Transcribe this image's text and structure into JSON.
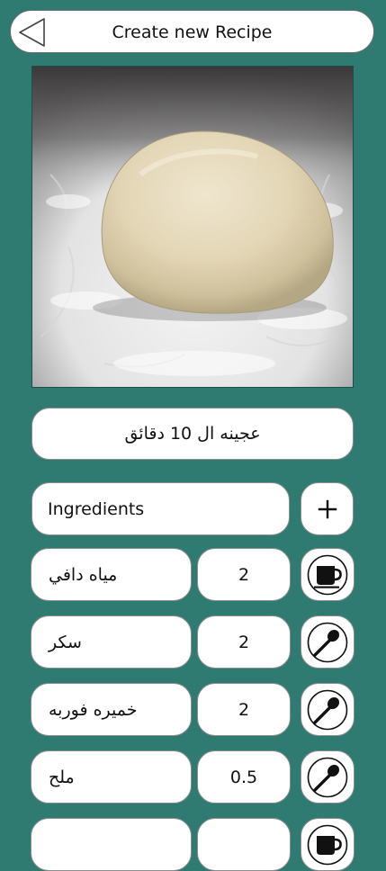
{
  "header": {
    "title": "Create new Recipe"
  },
  "recipe": {
    "name": "عجينه ال 10 دقائق",
    "image_description": "dough ball on floured surface"
  },
  "ingredients": {
    "header_label": "Ingredients",
    "add_symbol": "+",
    "rows": [
      {
        "name": "مياه دافي",
        "quantity": "2",
        "unit_icon": "cup-icon"
      },
      {
        "name": "سكر",
        "quantity": "2",
        "unit_icon": "spoon-icon"
      },
      {
        "name": "خميره فوربه",
        "quantity": "2",
        "unit_icon": "spoon-icon"
      },
      {
        "name": "ملح",
        "quantity": "0.5",
        "unit_icon": "spoon-icon"
      },
      {
        "name": "",
        "quantity": "",
        "unit_icon": "cup-icon"
      }
    ]
  },
  "colors": {
    "background": "#2f7b72",
    "card": "#ffffff",
    "border": "#8d8d8d"
  }
}
